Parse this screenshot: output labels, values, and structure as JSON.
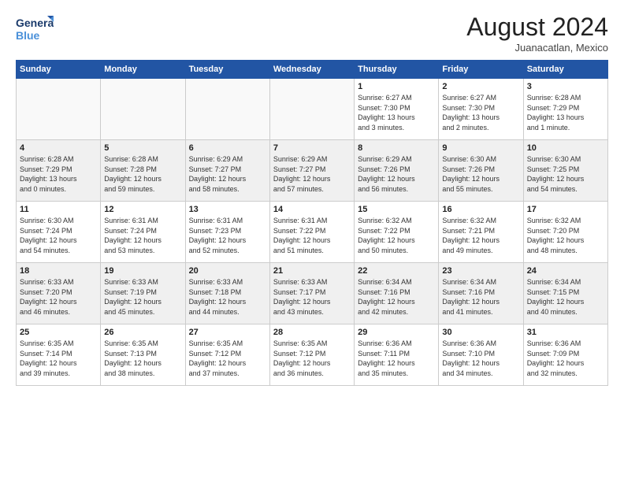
{
  "logo": {
    "line1": "General",
    "line2": "Blue"
  },
  "title": "August 2024",
  "location": "Juanacatlan, Mexico",
  "weekdays": [
    "Sunday",
    "Monday",
    "Tuesday",
    "Wednesday",
    "Thursday",
    "Friday",
    "Saturday"
  ],
  "weeks": [
    [
      {
        "day": "",
        "info": ""
      },
      {
        "day": "",
        "info": ""
      },
      {
        "day": "",
        "info": ""
      },
      {
        "day": "",
        "info": ""
      },
      {
        "day": "1",
        "info": "Sunrise: 6:27 AM\nSunset: 7:30 PM\nDaylight: 13 hours\nand 3 minutes."
      },
      {
        "day": "2",
        "info": "Sunrise: 6:27 AM\nSunset: 7:30 PM\nDaylight: 13 hours\nand 2 minutes."
      },
      {
        "day": "3",
        "info": "Sunrise: 6:28 AM\nSunset: 7:29 PM\nDaylight: 13 hours\nand 1 minute."
      }
    ],
    [
      {
        "day": "4",
        "info": "Sunrise: 6:28 AM\nSunset: 7:29 PM\nDaylight: 13 hours\nand 0 minutes."
      },
      {
        "day": "5",
        "info": "Sunrise: 6:28 AM\nSunset: 7:28 PM\nDaylight: 12 hours\nand 59 minutes."
      },
      {
        "day": "6",
        "info": "Sunrise: 6:29 AM\nSunset: 7:27 PM\nDaylight: 12 hours\nand 58 minutes."
      },
      {
        "day": "7",
        "info": "Sunrise: 6:29 AM\nSunset: 7:27 PM\nDaylight: 12 hours\nand 57 minutes."
      },
      {
        "day": "8",
        "info": "Sunrise: 6:29 AM\nSunset: 7:26 PM\nDaylight: 12 hours\nand 56 minutes."
      },
      {
        "day": "9",
        "info": "Sunrise: 6:30 AM\nSunset: 7:26 PM\nDaylight: 12 hours\nand 55 minutes."
      },
      {
        "day": "10",
        "info": "Sunrise: 6:30 AM\nSunset: 7:25 PM\nDaylight: 12 hours\nand 54 minutes."
      }
    ],
    [
      {
        "day": "11",
        "info": "Sunrise: 6:30 AM\nSunset: 7:24 PM\nDaylight: 12 hours\nand 54 minutes."
      },
      {
        "day": "12",
        "info": "Sunrise: 6:31 AM\nSunset: 7:24 PM\nDaylight: 12 hours\nand 53 minutes."
      },
      {
        "day": "13",
        "info": "Sunrise: 6:31 AM\nSunset: 7:23 PM\nDaylight: 12 hours\nand 52 minutes."
      },
      {
        "day": "14",
        "info": "Sunrise: 6:31 AM\nSunset: 7:22 PM\nDaylight: 12 hours\nand 51 minutes."
      },
      {
        "day": "15",
        "info": "Sunrise: 6:32 AM\nSunset: 7:22 PM\nDaylight: 12 hours\nand 50 minutes."
      },
      {
        "day": "16",
        "info": "Sunrise: 6:32 AM\nSunset: 7:21 PM\nDaylight: 12 hours\nand 49 minutes."
      },
      {
        "day": "17",
        "info": "Sunrise: 6:32 AM\nSunset: 7:20 PM\nDaylight: 12 hours\nand 48 minutes."
      }
    ],
    [
      {
        "day": "18",
        "info": "Sunrise: 6:33 AM\nSunset: 7:20 PM\nDaylight: 12 hours\nand 46 minutes."
      },
      {
        "day": "19",
        "info": "Sunrise: 6:33 AM\nSunset: 7:19 PM\nDaylight: 12 hours\nand 45 minutes."
      },
      {
        "day": "20",
        "info": "Sunrise: 6:33 AM\nSunset: 7:18 PM\nDaylight: 12 hours\nand 44 minutes."
      },
      {
        "day": "21",
        "info": "Sunrise: 6:33 AM\nSunset: 7:17 PM\nDaylight: 12 hours\nand 43 minutes."
      },
      {
        "day": "22",
        "info": "Sunrise: 6:34 AM\nSunset: 7:16 PM\nDaylight: 12 hours\nand 42 minutes."
      },
      {
        "day": "23",
        "info": "Sunrise: 6:34 AM\nSunset: 7:16 PM\nDaylight: 12 hours\nand 41 minutes."
      },
      {
        "day": "24",
        "info": "Sunrise: 6:34 AM\nSunset: 7:15 PM\nDaylight: 12 hours\nand 40 minutes."
      }
    ],
    [
      {
        "day": "25",
        "info": "Sunrise: 6:35 AM\nSunset: 7:14 PM\nDaylight: 12 hours\nand 39 minutes."
      },
      {
        "day": "26",
        "info": "Sunrise: 6:35 AM\nSunset: 7:13 PM\nDaylight: 12 hours\nand 38 minutes."
      },
      {
        "day": "27",
        "info": "Sunrise: 6:35 AM\nSunset: 7:12 PM\nDaylight: 12 hours\nand 37 minutes."
      },
      {
        "day": "28",
        "info": "Sunrise: 6:35 AM\nSunset: 7:12 PM\nDaylight: 12 hours\nand 36 minutes."
      },
      {
        "day": "29",
        "info": "Sunrise: 6:36 AM\nSunset: 7:11 PM\nDaylight: 12 hours\nand 35 minutes."
      },
      {
        "day": "30",
        "info": "Sunrise: 6:36 AM\nSunset: 7:10 PM\nDaylight: 12 hours\nand 34 minutes."
      },
      {
        "day": "31",
        "info": "Sunrise: 6:36 AM\nSunset: 7:09 PM\nDaylight: 12 hours\nand 32 minutes."
      }
    ]
  ]
}
